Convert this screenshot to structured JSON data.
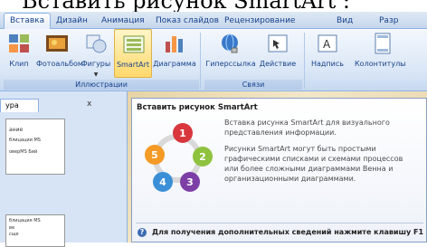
{
  "heading": "Вставить рисунок SmartArt :",
  "tabs": [
    "Вставка",
    "Дизайн",
    "Анимация",
    "Показ слайдов",
    "Рецензирование",
    "Вид",
    "Разр"
  ],
  "ribbon": {
    "buttons": {
      "clip": "Клип",
      "album": "Фотоальбом",
      "shapes": "Фигуры",
      "smartart": "SmartArt",
      "chart": "Диаграмма",
      "hyperlink": "Гиперссылка",
      "action": "Действие",
      "textbox": "Надпись",
      "header": "Колонтитулы"
    },
    "groups": {
      "illustrations": "Иллюстрации",
      "links": "Связи"
    }
  },
  "panel": {
    "tab_label": "ура",
    "close": "x",
    "thumb1_lines": [
      "ание",
      "блицации MS",
      "оверМS Бий"
    ],
    "thumb2_lines": [
      "блицация MS",
      "ве",
      "сще"
    ]
  },
  "tooltip": {
    "title": "Вставить рисунок SmartArt",
    "para1": [
      "Вставка рисунка SmartArt для визуального",
      "представления информации."
    ],
    "para2": [
      "Рисунки SmartArt могут быть простыми",
      "графическими списками и схемами процессов",
      "или более сложными диаграммами Венна и",
      "организационными диаграммами."
    ],
    "help": "Для получения дополнительных сведений нажмите клавишу F1",
    "diagram_numbers": [
      "1",
      "2",
      "3",
      "4",
      "5"
    ]
  }
}
